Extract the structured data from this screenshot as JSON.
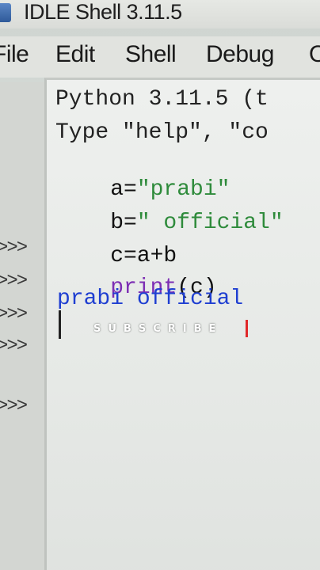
{
  "window": {
    "title": "IDLE Shell 3.11.5"
  },
  "menubar": {
    "items": [
      "File",
      "Edit",
      "Shell",
      "Debug",
      "Options"
    ]
  },
  "shell": {
    "banner_line1": "Python 3.11.5 (t",
    "banner_line2": "Type \"help\", \"co",
    "prompt": ">>>",
    "lines": [
      {
        "prompt": ">>>",
        "parts": [
          {
            "text": "a=",
            "kind": "plain"
          },
          {
            "text": "\"prabi\"",
            "kind": "string"
          }
        ]
      },
      {
        "prompt": ">>>",
        "parts": [
          {
            "text": "b=",
            "kind": "plain"
          },
          {
            "text": "\" official\"",
            "kind": "string"
          }
        ]
      },
      {
        "prompt": ">>>",
        "parts": [
          {
            "text": "c=a+b",
            "kind": "plain"
          }
        ]
      },
      {
        "prompt": ">>>",
        "parts": [
          {
            "text": "print",
            "kind": "builtin"
          },
          {
            "text": "(c)",
            "kind": "plain"
          }
        ]
      }
    ],
    "output": "prabi official",
    "current_prompt": ">>>"
  },
  "overlay": {
    "text": "SUBSCRIBE"
  },
  "colors": {
    "string": "#2e8b3b",
    "builtin": "#7d2fb4",
    "output": "#1f3fd1",
    "accent_bar": "#e0282a"
  }
}
